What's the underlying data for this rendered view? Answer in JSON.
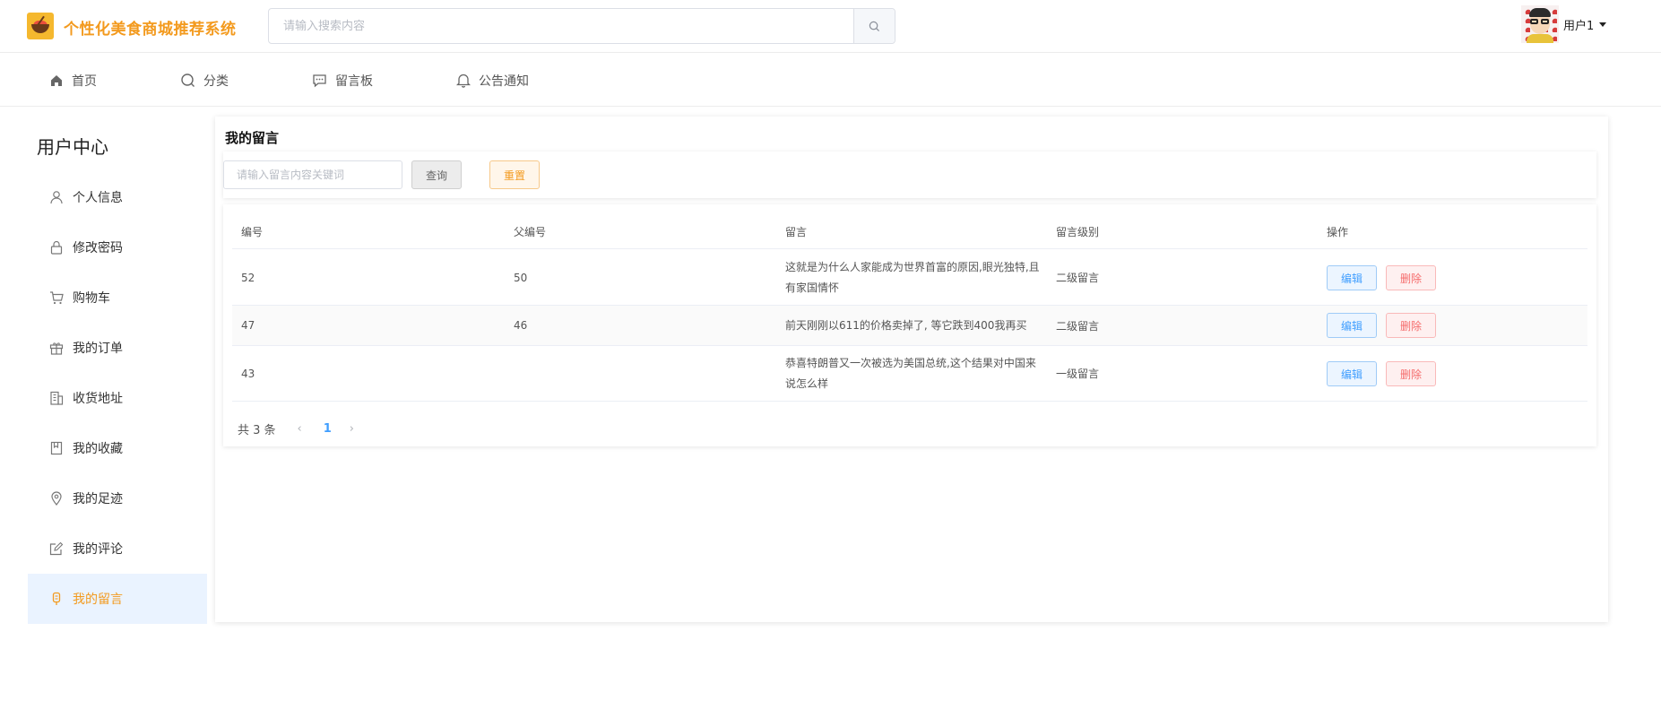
{
  "header": {
    "brand": "个性化美食商城推荐系统",
    "search_placeholder": "请输入搜索内容",
    "user_name": "用户1"
  },
  "nav": {
    "items": [
      {
        "label": "首页",
        "icon": "home-icon"
      },
      {
        "label": "分类",
        "icon": "category-icon"
      },
      {
        "label": "留言板",
        "icon": "message-board-icon"
      },
      {
        "label": "公告通知",
        "icon": "bell-icon"
      }
    ]
  },
  "sidebar": {
    "title": "用户中心",
    "items": [
      {
        "label": "个人信息",
        "icon": "user-icon"
      },
      {
        "label": "修改密码",
        "icon": "lock-icon"
      },
      {
        "label": "购物车",
        "icon": "cart-icon"
      },
      {
        "label": "我的订单",
        "icon": "gift-icon"
      },
      {
        "label": "收货地址",
        "icon": "building-icon"
      },
      {
        "label": "我的收藏",
        "icon": "bookmark-icon"
      },
      {
        "label": "我的足迹",
        "icon": "location-icon"
      },
      {
        "label": "我的评论",
        "icon": "edit-icon"
      },
      {
        "label": "我的留言",
        "icon": "microphone-icon",
        "active": true
      }
    ]
  },
  "main": {
    "title": "我的留言",
    "filter": {
      "placeholder": "请输入留言内容关键词",
      "query_label": "查询",
      "reset_label": "重置"
    },
    "table": {
      "columns": [
        "编号",
        "父编号",
        "留言",
        "留言级别",
        "操作"
      ],
      "rows": [
        {
          "id": "52",
          "parent_id": "50",
          "message": "这就是为什么人家能成为世界首富的原因,眼光独特,且有家国情怀",
          "level": "二级留言"
        },
        {
          "id": "47",
          "parent_id": "46",
          "message": "前天刚刚以611的价格卖掉了, 等它跌到400我再买",
          "level": "二级留言"
        },
        {
          "id": "43",
          "parent_id": "",
          "message": "恭喜特朗普又一次被选为美国总统,这个结果对中国来说怎么样",
          "level": "一级留言"
        }
      ],
      "edit_label": "编辑",
      "delete_label": "删除"
    },
    "pagination": {
      "total_text": "共 3 条",
      "current_page": "1",
      "prev": "‹",
      "next": "›"
    }
  },
  "colors": {
    "brand": "#f39a1e",
    "primary": "#409eff",
    "danger": "#f56c6c",
    "active_bg": "#eaf3ff"
  }
}
